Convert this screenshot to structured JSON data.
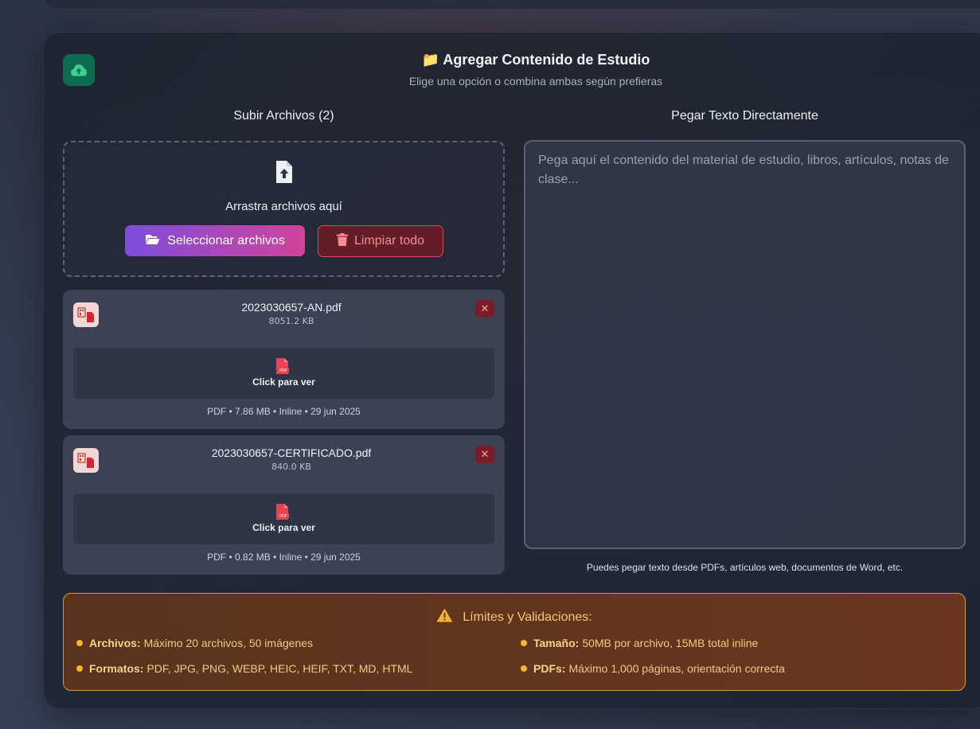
{
  "header": {
    "title": "📁 Agregar Contenido de Estudio",
    "subtitle": "Elige una opción o combina ambas según prefieras"
  },
  "upload": {
    "column_title": "Subir Archivos (2)",
    "drop_text": "Arrastra archivos aquí",
    "select_label": "Seleccionar archivos",
    "clear_label": "Limpiar todo"
  },
  "files": [
    {
      "name": "2023030657-AN.pdf",
      "size": "8051.2 KB",
      "preview_label": "Click para ver",
      "meta": "PDF • 7.86 MB • Inline • 29 jun 2025",
      "remove_label": "✕"
    },
    {
      "name": "2023030657-CERTIFICADO.pdf",
      "size": "840.0 KB",
      "preview_label": "Click para ver",
      "meta": "PDF • 0.82 MB • Inline • 29 jun 2025",
      "remove_label": "✕"
    }
  ],
  "paste": {
    "column_title": "Pegar Texto Directamente",
    "placeholder": "Pega aquí el contenido del material de estudio, libros, artículos, notas de clase...",
    "hint": "Puedes pegar texto desde PDFs, artículos web, documentos de Word, etc."
  },
  "limits": {
    "title": "Límites y Validaciones:",
    "items": [
      {
        "label": "Archivos:",
        "value": "Máximo 20 archivos, 50 imágenes"
      },
      {
        "label": "Tamaño:",
        "value": "50MB por archivo, 15MB total inline"
      },
      {
        "label": "Formatos:",
        "value": "PDF, JPG, PNG, WEBP, HEIC, HEIF, TXT, MD, HTML"
      },
      {
        "label": "PDFs:",
        "value": "Máximo 1,000 páginas, orientación correcta"
      }
    ]
  },
  "colors": {
    "accent_gradient_start": "#7c4ddb",
    "accent_gradient_end": "#d0449a",
    "danger": "#d94a58",
    "warning": "#f3b52f",
    "success_badge": "#0f6b4f"
  },
  "icons": {
    "header_badge": "cloud-upload-icon",
    "dropzone": "file-upload-icon",
    "select": "folder-open-icon",
    "clear": "trash-icon",
    "file_thumb": "file-type-icon",
    "preview": "pdf-icon",
    "remove": "close-icon",
    "limits": "warning-icon"
  }
}
